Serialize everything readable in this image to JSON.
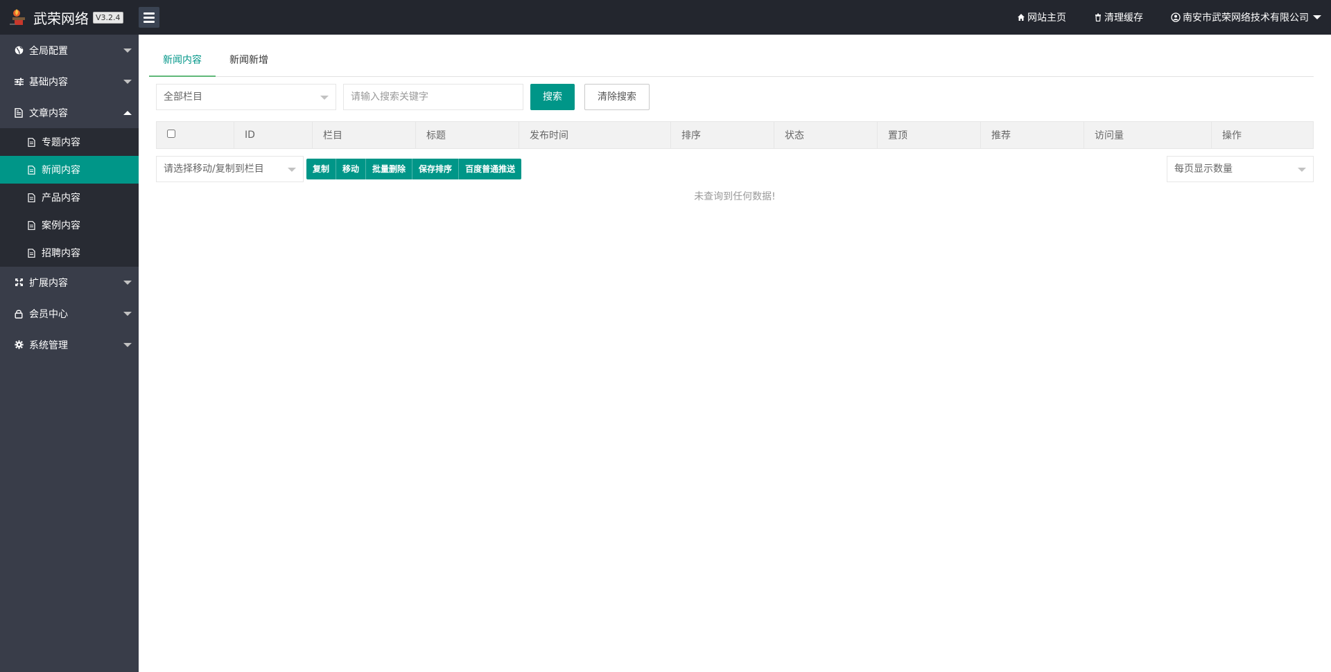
{
  "header": {
    "brand": "武荣网络",
    "version": "V3.2.4",
    "links": {
      "home": "网站主页",
      "clear_cache": "清理缓存",
      "user": "南安市武荣网络技术有限公司"
    }
  },
  "sidebar": {
    "items": [
      {
        "label": "全局配置",
        "icon": "globe-icon"
      },
      {
        "label": "基础内容",
        "icon": "sliders-icon"
      },
      {
        "label": "文章内容",
        "icon": "file-icon"
      },
      {
        "label": "扩展内容",
        "icon": "expand-icon"
      },
      {
        "label": "会员中心",
        "icon": "lock-icon"
      },
      {
        "label": "系统管理",
        "icon": "gear-icon"
      }
    ],
    "sub_items": [
      {
        "label": "专题内容"
      },
      {
        "label": "新闻内容"
      },
      {
        "label": "产品内容"
      },
      {
        "label": "案例内容"
      },
      {
        "label": "招聘内容"
      }
    ]
  },
  "tabs": [
    {
      "label": "新闻内容",
      "active": true
    },
    {
      "label": "新闻新增",
      "active": false
    }
  ],
  "search": {
    "category_select": "全部栏目",
    "keyword_placeholder": "请输入搜索关键字",
    "search_button": "搜索",
    "clear_button": "清除搜索"
  },
  "table": {
    "columns": [
      "ID",
      "栏目",
      "标题",
      "发布时间",
      "排序",
      "状态",
      "置顶",
      "推荐",
      "访问量",
      "操作"
    ]
  },
  "actions": {
    "move_select_placeholder": "请选择移动/复制到栏目",
    "buttons": [
      "复制",
      "移动",
      "批量删除",
      "保存排序",
      "百度普通推送"
    ],
    "page_size_placeholder": "每页显示数量"
  },
  "empty_message": "未查询到任何数据!",
  "colors": {
    "header_bg": "#23262e",
    "sidebar_bg": "#393d49",
    "submenu_bg": "#282b33",
    "accent": "#009688"
  }
}
